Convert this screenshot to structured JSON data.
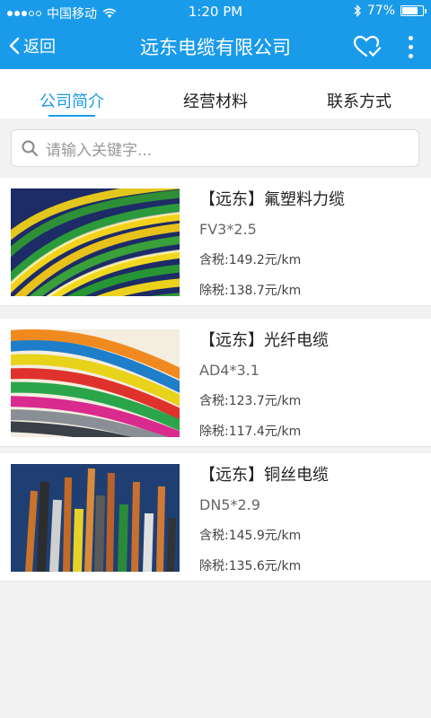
{
  "status_bar": {
    "carrier": "中国移动",
    "time": "1:20 PM",
    "battery_percent": "77%",
    "battery_level": 0.77
  },
  "nav": {
    "back_label": "返回",
    "title": "远东电缆有限公司"
  },
  "tabs": [
    {
      "label": "公司简介",
      "active": true
    },
    {
      "label": "经营材料",
      "active": false
    },
    {
      "label": "联系方式",
      "active": false
    }
  ],
  "search": {
    "placeholder": "请输入关键字..."
  },
  "products": [
    {
      "name": "【远东】氟塑料力缆",
      "model": "FV3*2.5",
      "tax_incl": "含税:149.2元/km",
      "tax_excl": "除税:138.7元/km"
    },
    {
      "name": "【远东】光纤电缆",
      "model": "AD4*3.1",
      "tax_incl": "含税:123.7元/km",
      "tax_excl": "除税:117.4元/km"
    },
    {
      "name": "【远东】铜丝电缆",
      "model": "DN5*2.9",
      "tax_incl": "含税:145.9元/km",
      "tax_excl": "除税:135.6元/km"
    }
  ],
  "colors": {
    "accent": "#1a9bea",
    "background": "#f2f2f2"
  }
}
